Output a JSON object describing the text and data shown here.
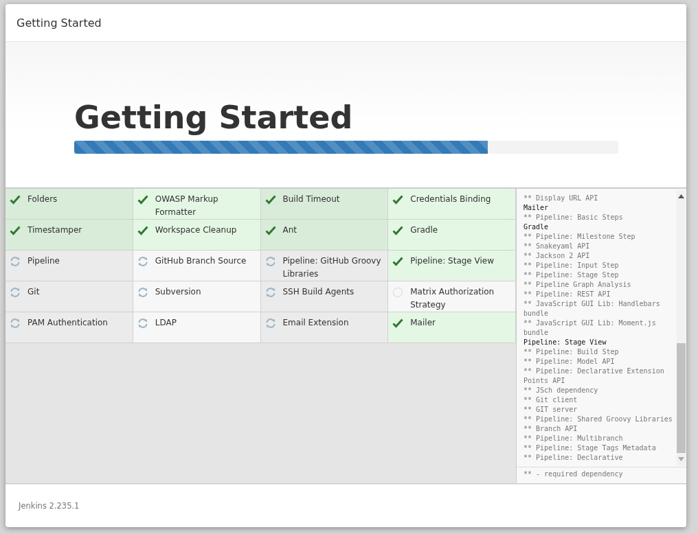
{
  "dialog": {
    "title": "Getting Started"
  },
  "hero": {
    "heading": "Getting Started",
    "progress": {
      "level": 0.76
    }
  },
  "plugins": [
    {
      "name": "Folders",
      "kind": "done"
    },
    {
      "name": "OWASP Markup Formatter",
      "kind": "done"
    },
    {
      "name": "Build Timeout",
      "kind": "done"
    },
    {
      "name": "Credentials Binding",
      "kind": "done"
    },
    {
      "name": "Timestamper",
      "kind": "done"
    },
    {
      "name": "Workspace Cleanup",
      "kind": "done"
    },
    {
      "name": "Ant",
      "kind": "done"
    },
    {
      "name": "Gradle",
      "kind": "done"
    },
    {
      "name": "Pipeline",
      "kind": "installing"
    },
    {
      "name": "GitHub Branch Source",
      "kind": "installing"
    },
    {
      "name": "Pipeline: GitHub Groovy Libraries",
      "kind": "installing"
    },
    {
      "name": "Pipeline: Stage View",
      "kind": "done"
    },
    {
      "name": "Git",
      "kind": "installing"
    },
    {
      "name": "Subversion",
      "kind": "installing"
    },
    {
      "name": "SSH Build Agents",
      "kind": "installing"
    },
    {
      "name": "Matrix Authorization Strategy",
      "kind": "pending"
    },
    {
      "name": "PAM Authentication",
      "kind": "installing"
    },
    {
      "name": "LDAP",
      "kind": "installing"
    },
    {
      "name": "Email Extension",
      "kind": "installing"
    },
    {
      "name": "Mailer",
      "kind": "done"
    }
  ],
  "log": {
    "lines": [
      {
        "text": "** Display URL API",
        "kind": "dependency"
      },
      {
        "text": "Mailer",
        "kind": "plugin"
      },
      {
        "text": "** Pipeline: Basic Steps",
        "kind": "dependency"
      },
      {
        "text": "Gradle",
        "kind": "plugin"
      },
      {
        "text": "** Pipeline: Milestone Step",
        "kind": "dependency"
      },
      {
        "text": "** Snakeyaml API",
        "kind": "dependency"
      },
      {
        "text": "** Jackson 2 API",
        "kind": "dependency"
      },
      {
        "text": "** Pipeline: Input Step",
        "kind": "dependency"
      },
      {
        "text": "** Pipeline: Stage Step",
        "kind": "dependency"
      },
      {
        "text": "** Pipeline Graph Analysis",
        "kind": "dependency"
      },
      {
        "text": "** Pipeline: REST API",
        "kind": "dependency"
      },
      {
        "text": "** JavaScript GUI Lib: Handlebars bundle",
        "kind": "dependency"
      },
      {
        "text": "** JavaScript GUI Lib: Moment.js bundle",
        "kind": "dependency"
      },
      {
        "text": "Pipeline: Stage View",
        "kind": "plugin"
      },
      {
        "text": "** Pipeline: Build Step",
        "kind": "dependency"
      },
      {
        "text": "** Pipeline: Model API",
        "kind": "dependency"
      },
      {
        "text": "** Pipeline: Declarative Extension Points API",
        "kind": "dependency"
      },
      {
        "text": "** JSch dependency",
        "kind": "dependency"
      },
      {
        "text": "** Git client",
        "kind": "dependency"
      },
      {
        "text": "** GIT server",
        "kind": "dependency"
      },
      {
        "text": "** Pipeline: Shared Groovy Libraries",
        "kind": "dependency"
      },
      {
        "text": "** Branch API",
        "kind": "dependency"
      },
      {
        "text": "** Pipeline: Multibranch",
        "kind": "dependency"
      },
      {
        "text": "** Pipeline: Stage Tags Metadata",
        "kind": "dependency"
      },
      {
        "text": "** Pipeline: Declarative",
        "kind": "dependency"
      }
    ],
    "legend": "** - required dependency"
  },
  "footer": {
    "version": "Jenkins 2.235.1"
  }
}
